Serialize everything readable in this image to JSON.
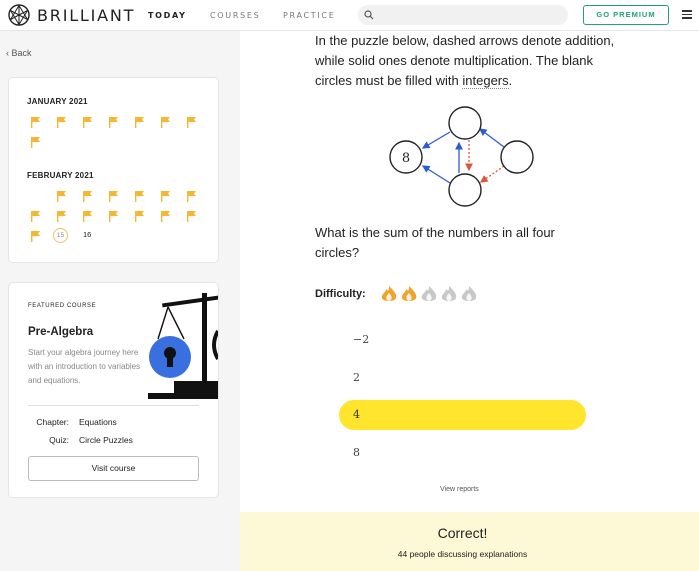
{
  "nav": {
    "brand": "BRILLIANT",
    "tabs": [
      "TODAY",
      "COURSES",
      "PRACTICE"
    ],
    "active_tab": "TODAY",
    "search_placeholder": "",
    "premium_label": "GO PREMIUM",
    "accent": "#1fa27a"
  },
  "sidebar": {
    "back_label": "Back",
    "calendar": {
      "months": [
        {
          "name": "JANUARY 2021",
          "completed_flags": 8
        },
        {
          "name": "FEBRUARY 2021",
          "completed_flags": 14,
          "current_day": "15",
          "next_day": "16"
        }
      ],
      "flag_color": "#f5b731"
    },
    "featured_course": {
      "eyebrow": "FEATURED COURSE",
      "title": "Pre-Algebra",
      "description": "Start your algebra journey here with an introduction to variables and equations.",
      "chapter_label": "Chapter:",
      "chapter_value": "Equations",
      "quiz_label": "Quiz:",
      "quiz_value": "Circle Puzzles",
      "button_label": "Visit course"
    }
  },
  "problem": {
    "prompt_before": "In the puzzle below, dashed arrows denote addition, while solid ones denote multiplication. The blank circles must be filled with ",
    "prompt_link": "integers",
    "prompt_after": ".",
    "given_value": "8",
    "question": "What is the sum of the numbers in all four circles?",
    "difficulty_label": "Difficulty:",
    "difficulty_level": 2,
    "difficulty_max": 5,
    "options": [
      "−2",
      "2",
      "4",
      "8"
    ],
    "selected_option": "4",
    "view_reports": "View reports",
    "result_title": "Correct!",
    "result_subtitle": "44 people discussing explanations",
    "highlight_color": "#ffe52b"
  }
}
